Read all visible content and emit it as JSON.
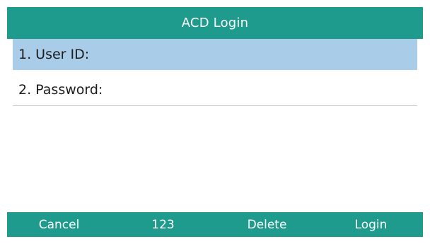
{
  "window": {
    "title": "ACD Login"
  },
  "form": {
    "fields": [
      {
        "label": "1. User ID:",
        "value": ""
      },
      {
        "label": "2. Password:",
        "value": ""
      }
    ]
  },
  "softkeys": [
    "Cancel",
    "123",
    "Delete",
    "Login"
  ],
  "colors": {
    "accent": "#1e9b8c",
    "selection": "#a9cde9",
    "text": "#1c1c1c",
    "divider": "#c8c8c8"
  }
}
